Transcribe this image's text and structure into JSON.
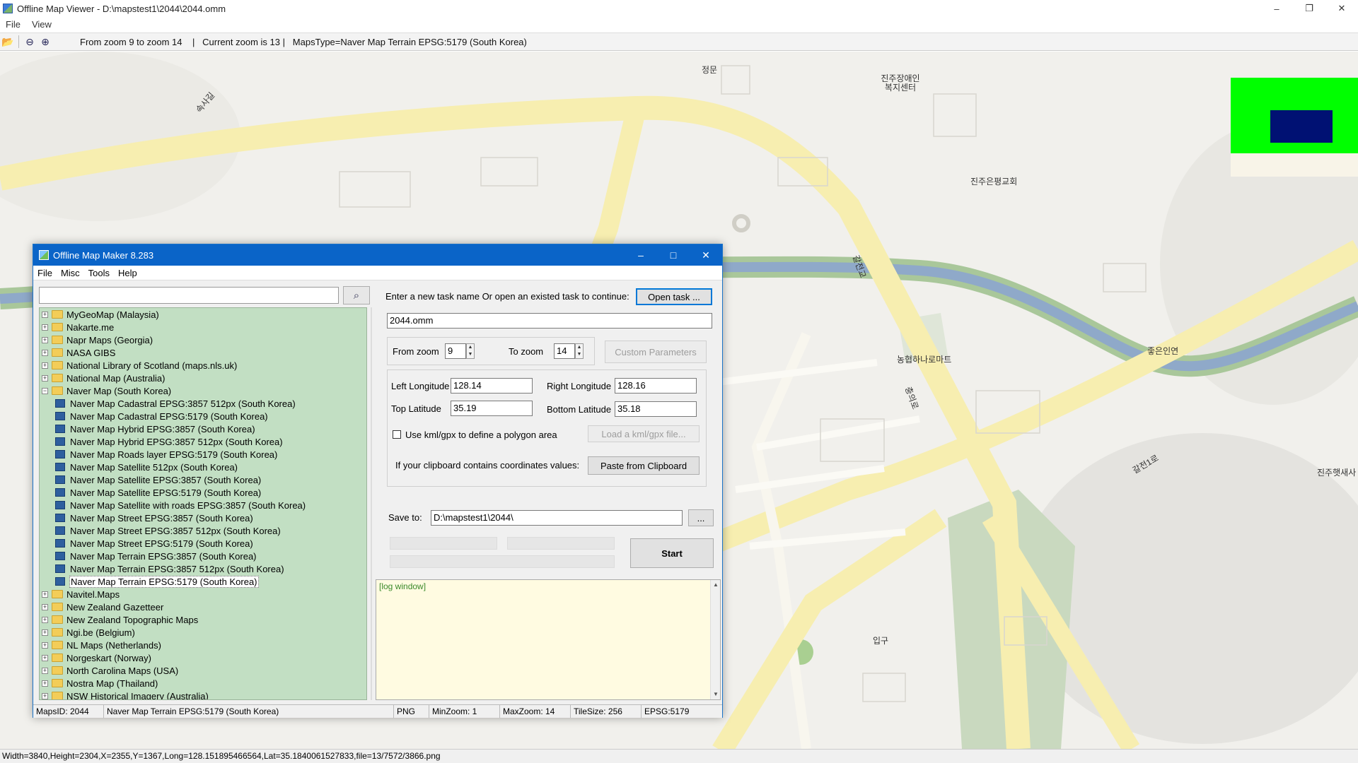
{
  "window": {
    "title": "Offline Map Viewer - D:\\mapstest1\\2044\\2044.omm",
    "controls": [
      "minimize",
      "maximize",
      "close"
    ]
  },
  "menu": [
    "File",
    "View"
  ],
  "toolbar": {
    "info": "From zoom 9 to zoom 14    |   Current zoom is 13 |   MapsType=Naver Map Terrain EPSG:5179 (South Korea)"
  },
  "map": {
    "labels": [
      "정문",
      "진주장애인\n복지센터",
      "진주은평교회",
      "농협하나로마트",
      "좋은인연",
      "진주햇새사",
      "입구",
      "속사길",
      "갈전교",
      "충의로",
      "갈전1로"
    ],
    "colors": {
      "road": "#f7eeb0",
      "river": "#8fa9c9",
      "riverbank": "#a9c79a",
      "land": "#f1f0ec"
    }
  },
  "statusbar": {
    "text": "Width=3840,Height=2304,X=2355,Y=1367,Long=128.151895466564,Lat=35.1840061527833,file=13/7572/3866.png"
  },
  "dialog": {
    "title": "Offline Map Maker 8.283",
    "menu": [
      "File",
      "Misc",
      "Tools",
      "Help"
    ],
    "search": {
      "value": "",
      "icon": "search-icon"
    },
    "tree": [
      {
        "label": "MyGeoMap (Malaysia)",
        "type": "folder"
      },
      {
        "label": "Nakarte.me",
        "type": "folder"
      },
      {
        "label": "Napr Maps (Georgia)",
        "type": "folder"
      },
      {
        "label": "NASA GIBS",
        "type": "folder"
      },
      {
        "label": "National Library of Scotland (maps.nls.uk)",
        "type": "folder"
      },
      {
        "label": "National Map (Australia)",
        "type": "folder"
      },
      {
        "label": "Naver Map (South Korea)",
        "type": "folder-open"
      },
      {
        "label": "Naver Map Cadastral EPSG:3857 512px (South Korea)",
        "type": "leaf"
      },
      {
        "label": "Naver Map Cadastral EPSG:5179 (South Korea)",
        "type": "leaf"
      },
      {
        "label": "Naver Map Hybrid EPSG:3857 (South Korea)",
        "type": "leaf"
      },
      {
        "label": "Naver Map Hybrid EPSG:3857 512px (South Korea)",
        "type": "leaf"
      },
      {
        "label": "Naver Map Roads layer EPSG:5179 (South Korea)",
        "type": "leaf"
      },
      {
        "label": "Naver Map Satellite 512px (South Korea)",
        "type": "leaf"
      },
      {
        "label": "Naver Map Satellite EPSG:3857 (South Korea)",
        "type": "leaf"
      },
      {
        "label": "Naver Map Satellite EPSG:5179 (South Korea)",
        "type": "leaf"
      },
      {
        "label": "Naver Map Satellite with roads EPSG:3857 (South Korea)",
        "type": "leaf"
      },
      {
        "label": "Naver Map Street EPSG:3857 (South Korea)",
        "type": "leaf"
      },
      {
        "label": "Naver Map Street EPSG:3857 512px (South Korea)",
        "type": "leaf"
      },
      {
        "label": "Naver Map Street EPSG:5179 (South Korea)",
        "type": "leaf"
      },
      {
        "label": "Naver Map Terrain EPSG:3857 (South Korea)",
        "type": "leaf"
      },
      {
        "label": "Naver Map Terrain EPSG:3857 512px (South Korea)",
        "type": "leaf"
      },
      {
        "label": "Naver Map Terrain EPSG:5179 (South Korea)",
        "type": "leaf",
        "selected": true
      },
      {
        "label": "Navitel.Maps",
        "type": "folder"
      },
      {
        "label": "New Zealand Gazetteer",
        "type": "folder"
      },
      {
        "label": "New Zealand Topographic Maps",
        "type": "folder"
      },
      {
        "label": "Ngi.be (Belgium)",
        "type": "folder"
      },
      {
        "label": "NL Maps (Netherlands)",
        "type": "folder"
      },
      {
        "label": "Norgeskart (Norway)",
        "type": "folder"
      },
      {
        "label": "North Carolina Maps (USA)",
        "type": "folder"
      },
      {
        "label": "Nostra Map (Thailand)",
        "type": "folder"
      },
      {
        "label": "NSW Historical Imagery (Australia)",
        "type": "folder"
      }
    ],
    "task": {
      "prompt": "Enter a new task name Or open an existed task to continue:",
      "open_button": "Open task ...",
      "name": "2044.omm"
    },
    "zoom": {
      "from_label": "From zoom",
      "from_value": "9",
      "to_label": "To zoom",
      "to_value": "14",
      "custom_button": "Custom Parameters"
    },
    "coords": {
      "left_lon_label": "Left Longitude",
      "left_lon": "128.14",
      "right_lon_label": "Right Longitude",
      "right_lon": "128.16",
      "top_lat_label": "Top Latitude",
      "top_lat": "35.19",
      "bottom_lat_label": "Bottom Latitude",
      "bottom_lat": "35.18",
      "kml_label": "Use kml/gpx to define a polygon area",
      "kml_checked": false,
      "kml_button": "Load a kml/gpx file...",
      "clipboard_label": "If your clipboard contains coordinates values:",
      "clipboard_button": "Paste from Clipboard"
    },
    "save": {
      "label": "Save to:",
      "path": "D:\\mapstest1\\2044\\",
      "browse": "..."
    },
    "start_button": "Start",
    "log": "[log window]",
    "status": {
      "maps_id": "MapsID: 2044",
      "map_type": "Naver Map Terrain EPSG:5179 (South Korea)",
      "format": "PNG",
      "min_zoom": "MinZoom: 1",
      "max_zoom": "MaxZoom: 14",
      "tile_size": "TileSize: 256",
      "epsg": "EPSG:5179"
    }
  }
}
